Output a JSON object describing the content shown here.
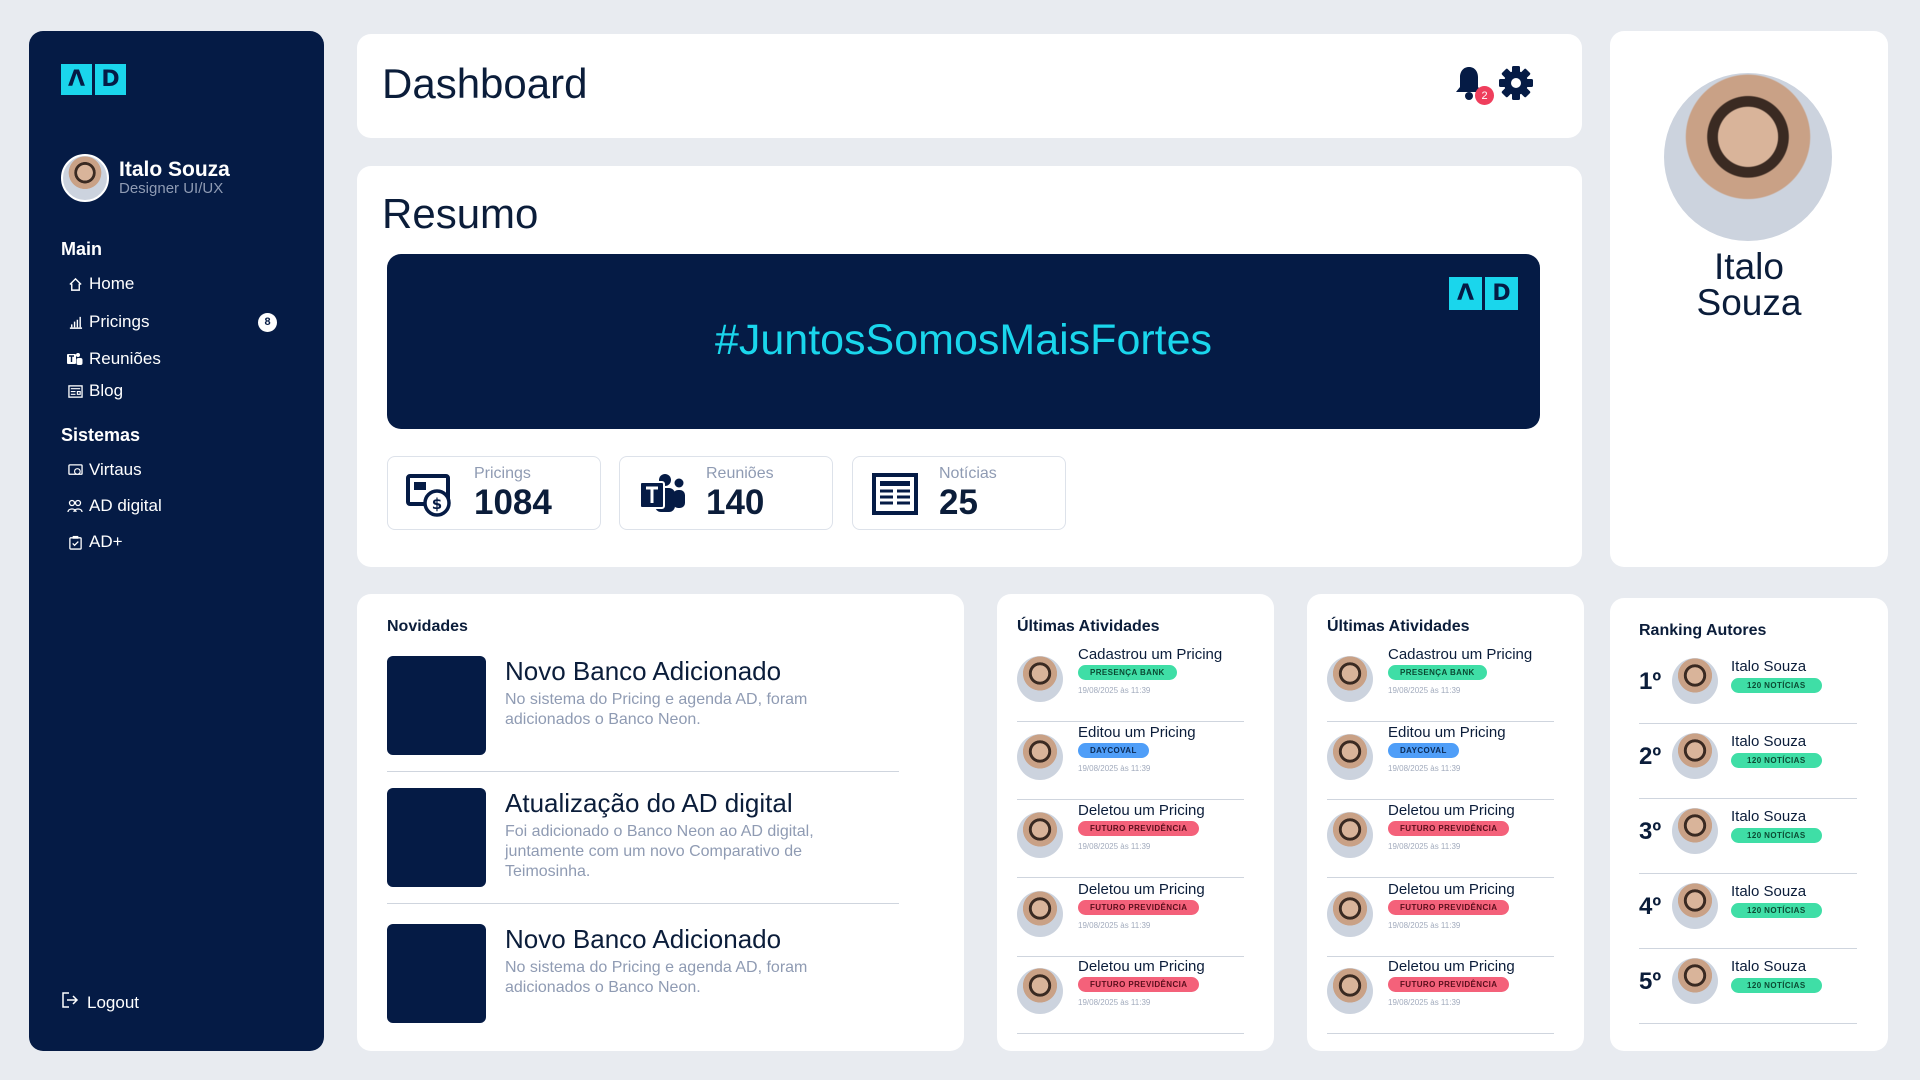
{
  "brand": {
    "logo_letters": [
      "Λ",
      "D"
    ],
    "accent": "#1ad6ec",
    "navy": "#051b45"
  },
  "sidebar": {
    "user": {
      "name": "Italo Souza",
      "role": "Designer UI/UX"
    },
    "sections": [
      {
        "title": "Main",
        "items": [
          {
            "label": "Home",
            "icon": "home-icon"
          },
          {
            "label": "Pricings",
            "icon": "bar-chart-icon",
            "badge": "8"
          },
          {
            "label": "Reuniões",
            "icon": "teams-icon"
          },
          {
            "label": "Blog",
            "icon": "newspaper-icon"
          }
        ]
      },
      {
        "title": "Sistemas",
        "items": [
          {
            "label": "Virtaus",
            "icon": "monitor-icon"
          },
          {
            "label": "AD digital",
            "icon": "users-icon"
          },
          {
            "label": "AD+",
            "icon": "clipboard-check-icon"
          }
        ]
      }
    ],
    "logout_label": "Logout"
  },
  "header": {
    "title": "Dashboard",
    "notification_count": "2"
  },
  "resumo": {
    "title": "Resumo",
    "banner_text": "#JuntosSomosMaisFortes",
    "stats": [
      {
        "label": "Pricings",
        "value": "1084",
        "icon": "money-icon"
      },
      {
        "label": "Reuniões",
        "value": "140",
        "icon": "teams-icon"
      },
      {
        "label": "Notícias",
        "value": "25",
        "icon": "newspaper-icon"
      }
    ]
  },
  "profile": {
    "first_name": "Italo",
    "last_name": "Souza"
  },
  "novidades": {
    "title": "Novidades",
    "items": [
      {
        "title": "Novo Banco Adicionado",
        "text": "No sistema do Pricing e agenda AD, foram adicionados o Banco Neon."
      },
      {
        "title": "Atualização do AD digital",
        "text": "Foi adicionado o Banco Neon ao AD digital, juntamente com um novo Comparativo de Teimosinha."
      },
      {
        "title": "Novo Banco Adicionado",
        "text": "No sistema do Pricing e agenda AD, foram adicionados o Banco Neon."
      }
    ]
  },
  "atividades": {
    "title": "Últimas Atividades",
    "items": [
      {
        "action": "Cadastrou um Pricing",
        "tag": "PRESENÇA BANK",
        "tag_color": "green",
        "date": "19/08/2025 às 11:39"
      },
      {
        "action": "Editou um Pricing",
        "tag": "DAYCOVAL",
        "tag_color": "blue",
        "date": "19/08/2025 às 11:39"
      },
      {
        "action": "Deletou um Pricing",
        "tag": "FUTURO PREVIDÊNCIA",
        "tag_color": "red",
        "date": "19/08/2025 às 11:39"
      },
      {
        "action": "Deletou um Pricing",
        "tag": "FUTURO PREVIDÊNCIA",
        "tag_color": "red",
        "date": "19/08/2025 às 11:39"
      },
      {
        "action": "Deletou um Pricing",
        "tag": "FUTURO PREVIDÊNCIA",
        "tag_color": "red",
        "date": "19/08/2025 às 11:39"
      }
    ]
  },
  "ranking": {
    "title": "Ranking Autores",
    "items": [
      {
        "pos": "1º",
        "name": "Italo Souza",
        "tag": "120 NOTÍCIAS"
      },
      {
        "pos": "2º",
        "name": "Italo Souza",
        "tag": "120 NOTÍCIAS"
      },
      {
        "pos": "3º",
        "name": "Italo Souza",
        "tag": "120 NOTÍCIAS"
      },
      {
        "pos": "4º",
        "name": "Italo Souza",
        "tag": "120 NOTÍCIAS"
      },
      {
        "pos": "5º",
        "name": "Italo Souza",
        "tag": "120 NOTÍCIAS"
      }
    ]
  }
}
